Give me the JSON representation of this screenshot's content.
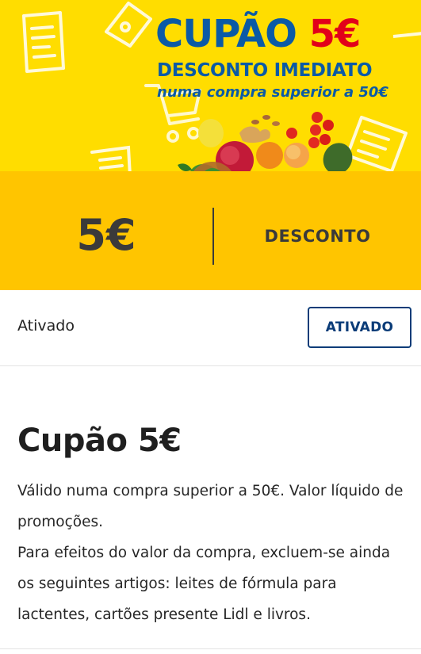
{
  "banner": {
    "title": "CUPÃO",
    "title_amount": "5€",
    "subtitle": "DESCONTO IMEDIATO",
    "condition": "numa compra superior a 50€"
  },
  "value": {
    "amount": "5€",
    "label": "DESCONTO"
  },
  "status": {
    "text": "Ativado",
    "button_label": "ATIVADO"
  },
  "details": {
    "title": "Cupão 5€",
    "paragraph_1": "Válido numa compra superior a 50€. Valor líquido de promoções.",
    "paragraph_2": "Para efeitos do valor da compra, excluem-se ainda os seguintes artigos: leites de fórmula para lactentes, cartões presente Lidl e livros."
  },
  "colors": {
    "banner_yellow": "#ffdd00",
    "strip_orange": "#ffc500",
    "brand_blue": "#0b5aa6",
    "accent_red": "#e2001a",
    "button_navy": "#0b3c78"
  }
}
